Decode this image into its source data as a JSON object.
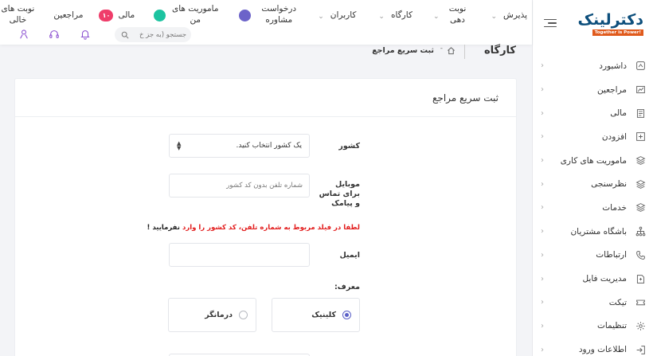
{
  "sidebar": {
    "logo_text": "دکترلینک",
    "logo_tagline": "Together is Power!",
    "items": [
      {
        "label": "داشبورد",
        "icon": "dashboard-icon"
      },
      {
        "label": "مراجعین",
        "icon": "chart-icon"
      },
      {
        "label": "مالی",
        "icon": "file-stack-icon"
      },
      {
        "label": "افزودن",
        "icon": "add-box-icon"
      },
      {
        "label": "ماموریت های کاری",
        "icon": "layers-icon"
      },
      {
        "label": "نظرسنجی",
        "icon": "layers-icon"
      },
      {
        "label": "خدمات",
        "icon": "layers-icon"
      },
      {
        "label": "باشگاه مشتریان",
        "icon": "sitemap-icon"
      },
      {
        "label": "ارتباطات",
        "icon": "phone-icon"
      },
      {
        "label": "مدیریت فایل",
        "icon": "file-manager-icon"
      },
      {
        "label": "تیکت",
        "icon": "ticket-icon"
      },
      {
        "label": "تنظیمات",
        "icon": "gear-icon"
      },
      {
        "label": "اطلاعات ورود",
        "icon": "login-icon"
      }
    ]
  },
  "topnav": {
    "items": [
      {
        "label": "پذیرش",
        "has_chevron": true
      },
      {
        "label": "نوبت دهی",
        "has_chevron": true
      },
      {
        "label": "کارگاه",
        "has_chevron": true
      },
      {
        "label": "کاربران",
        "has_chevron": true
      },
      {
        "label": "درخواست مشاوره",
        "badge": "",
        "badge_color": "#6c63c9"
      },
      {
        "label": "ماموریت های من",
        "badge": "",
        "badge_color": "#1cc3a0"
      },
      {
        "label": "مالی",
        "badge": "۱۰",
        "badge_color": "#ef3d6a"
      },
      {
        "label": "مراجعین"
      },
      {
        "label": "نوبت های خالی"
      }
    ],
    "search_placeholder": "جستجو (به جز خ",
    "icons": [
      "bell-icon",
      "headset-icon",
      "user-icon"
    ]
  },
  "breadcrumb": {
    "title": "کارگاه",
    "current": "ثبت سریع مراجع"
  },
  "form": {
    "title": "ثبت سریع مراجع",
    "country_label": "کشور",
    "country_value": "یک کشور انتخاب کنید.",
    "mobile_label": "موبایل برای تماس و پیامک",
    "mobile_placeholder": "شماره تلفن بدون کد کشور",
    "warning_red": "لطفا در فیلد مربوط به شماره تلفن، کد کشور را وارد",
    "warning_black": "نفرمایید !",
    "email_label": "ایمیل",
    "email_value": "",
    "referrer_label": "معرف:",
    "radio_options": [
      {
        "label": "کلینیک",
        "checked": true
      },
      {
        "label": "درمانگر",
        "checked": false
      }
    ]
  },
  "colors": {
    "accent": "#5a5fc7",
    "warning": "#e21b1b",
    "logo": "#0d4f7c",
    "logo_tag_bg": "#e05a1c"
  }
}
